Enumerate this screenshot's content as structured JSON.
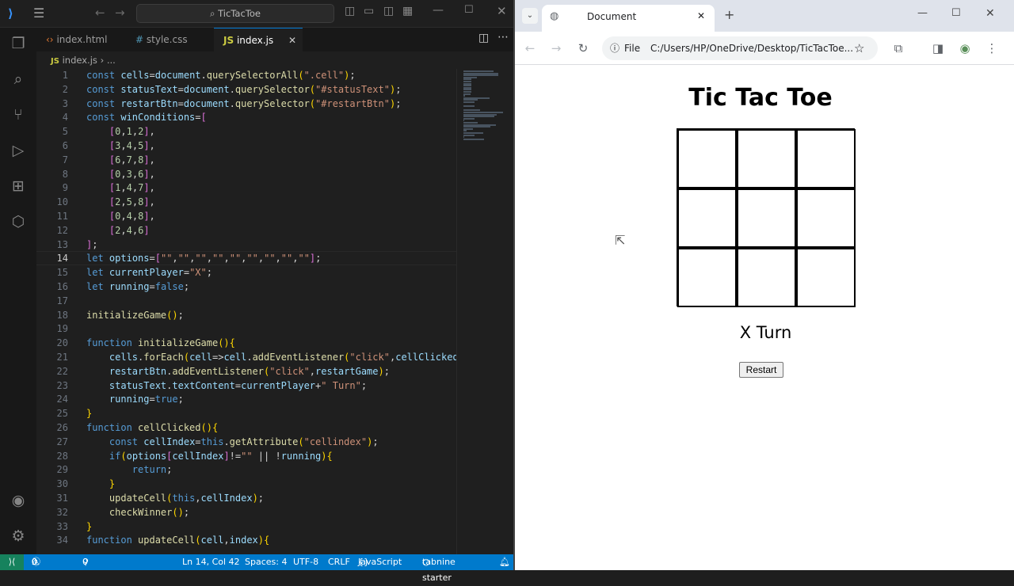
{
  "vscode": {
    "search_label": "TicTacToe",
    "tabs": [
      {
        "label": "index.html",
        "icon": "html-file-icon"
      },
      {
        "label": "style.css",
        "icon": "css-file-icon"
      },
      {
        "label": "index.js",
        "icon": "js-file-icon",
        "active": true
      }
    ],
    "breadcrumb": {
      "file": "index.js",
      "rest": "..."
    },
    "line_numbers": [
      "1",
      "2",
      "3",
      "4",
      "5",
      "6",
      "7",
      "8",
      "9",
      "10",
      "11",
      "12",
      "13",
      "14",
      "15",
      "16",
      "17",
      "18",
      "19",
      "20",
      "21",
      "22",
      "23",
      "24",
      "25",
      "26",
      "27",
      "28",
      "29",
      "30",
      "31",
      "32",
      "33",
      "34"
    ],
    "code_lines": [
      "const cells=document.querySelectorAll(\".cell\");",
      "const statusText=document.querySelector(\"#statusText\");",
      "const restartBtn=document.querySelector(\"#restartBtn\");",
      "const winConditions=[",
      "    [0,1,2],",
      "    [3,4,5],",
      "    [6,7,8],",
      "    [0,3,6],",
      "    [1,4,7],",
      "    [2,5,8],",
      "    [0,4,8],",
      "    [2,4,6]",
      "];",
      "let options=[\"\",\"\",\"\",\"\",\"\",\"\",\"\",\"\",\"\"];",
      "let currentPlayer=\"X\";",
      "let running=false;",
      "",
      "initializeGame();",
      "",
      "function initializeGame(){",
      "    cells.forEach(cell=>cell.addEventListener(\"click\",cellClicked",
      "    restartBtn.addEventListener(\"click\",restartGame);",
      "    statusText.textContent=currentPlayer+\" Turn\";",
      "    running=true;",
      "}",
      "function cellClicked(){",
      "    const cellIndex=this.getAttribute(\"cellindex\");",
      "    if(options[cellIndex]!=\"\" || !running){",
      "        return;",
      "    }",
      "    updateCell(this,cellIndex);",
      "    checkWinner();",
      "}",
      "function updateCell(cell,index){"
    ],
    "status_bar": {
      "errors": "0",
      "warnings": "0",
      "ports": "0",
      "position": "Ln 14, Col 42",
      "spaces": "Spaces: 4",
      "encoding": "UTF-8",
      "eol": "CRLF",
      "language": "JavaScript",
      "extension": "tabnine starter"
    },
    "accent_color": "#007acc"
  },
  "browser": {
    "tab_title": "Document",
    "url_prefix": "File",
    "url": "C:/Users/HP/OneDrive/Desktop/TicTacToe...",
    "page": {
      "title": "Tic Tac Toe",
      "status_text": "X Turn",
      "restart_label": "Restart",
      "cells": [
        "",
        "",
        "",
        "",
        "",
        "",
        "",
        "",
        ""
      ]
    }
  }
}
